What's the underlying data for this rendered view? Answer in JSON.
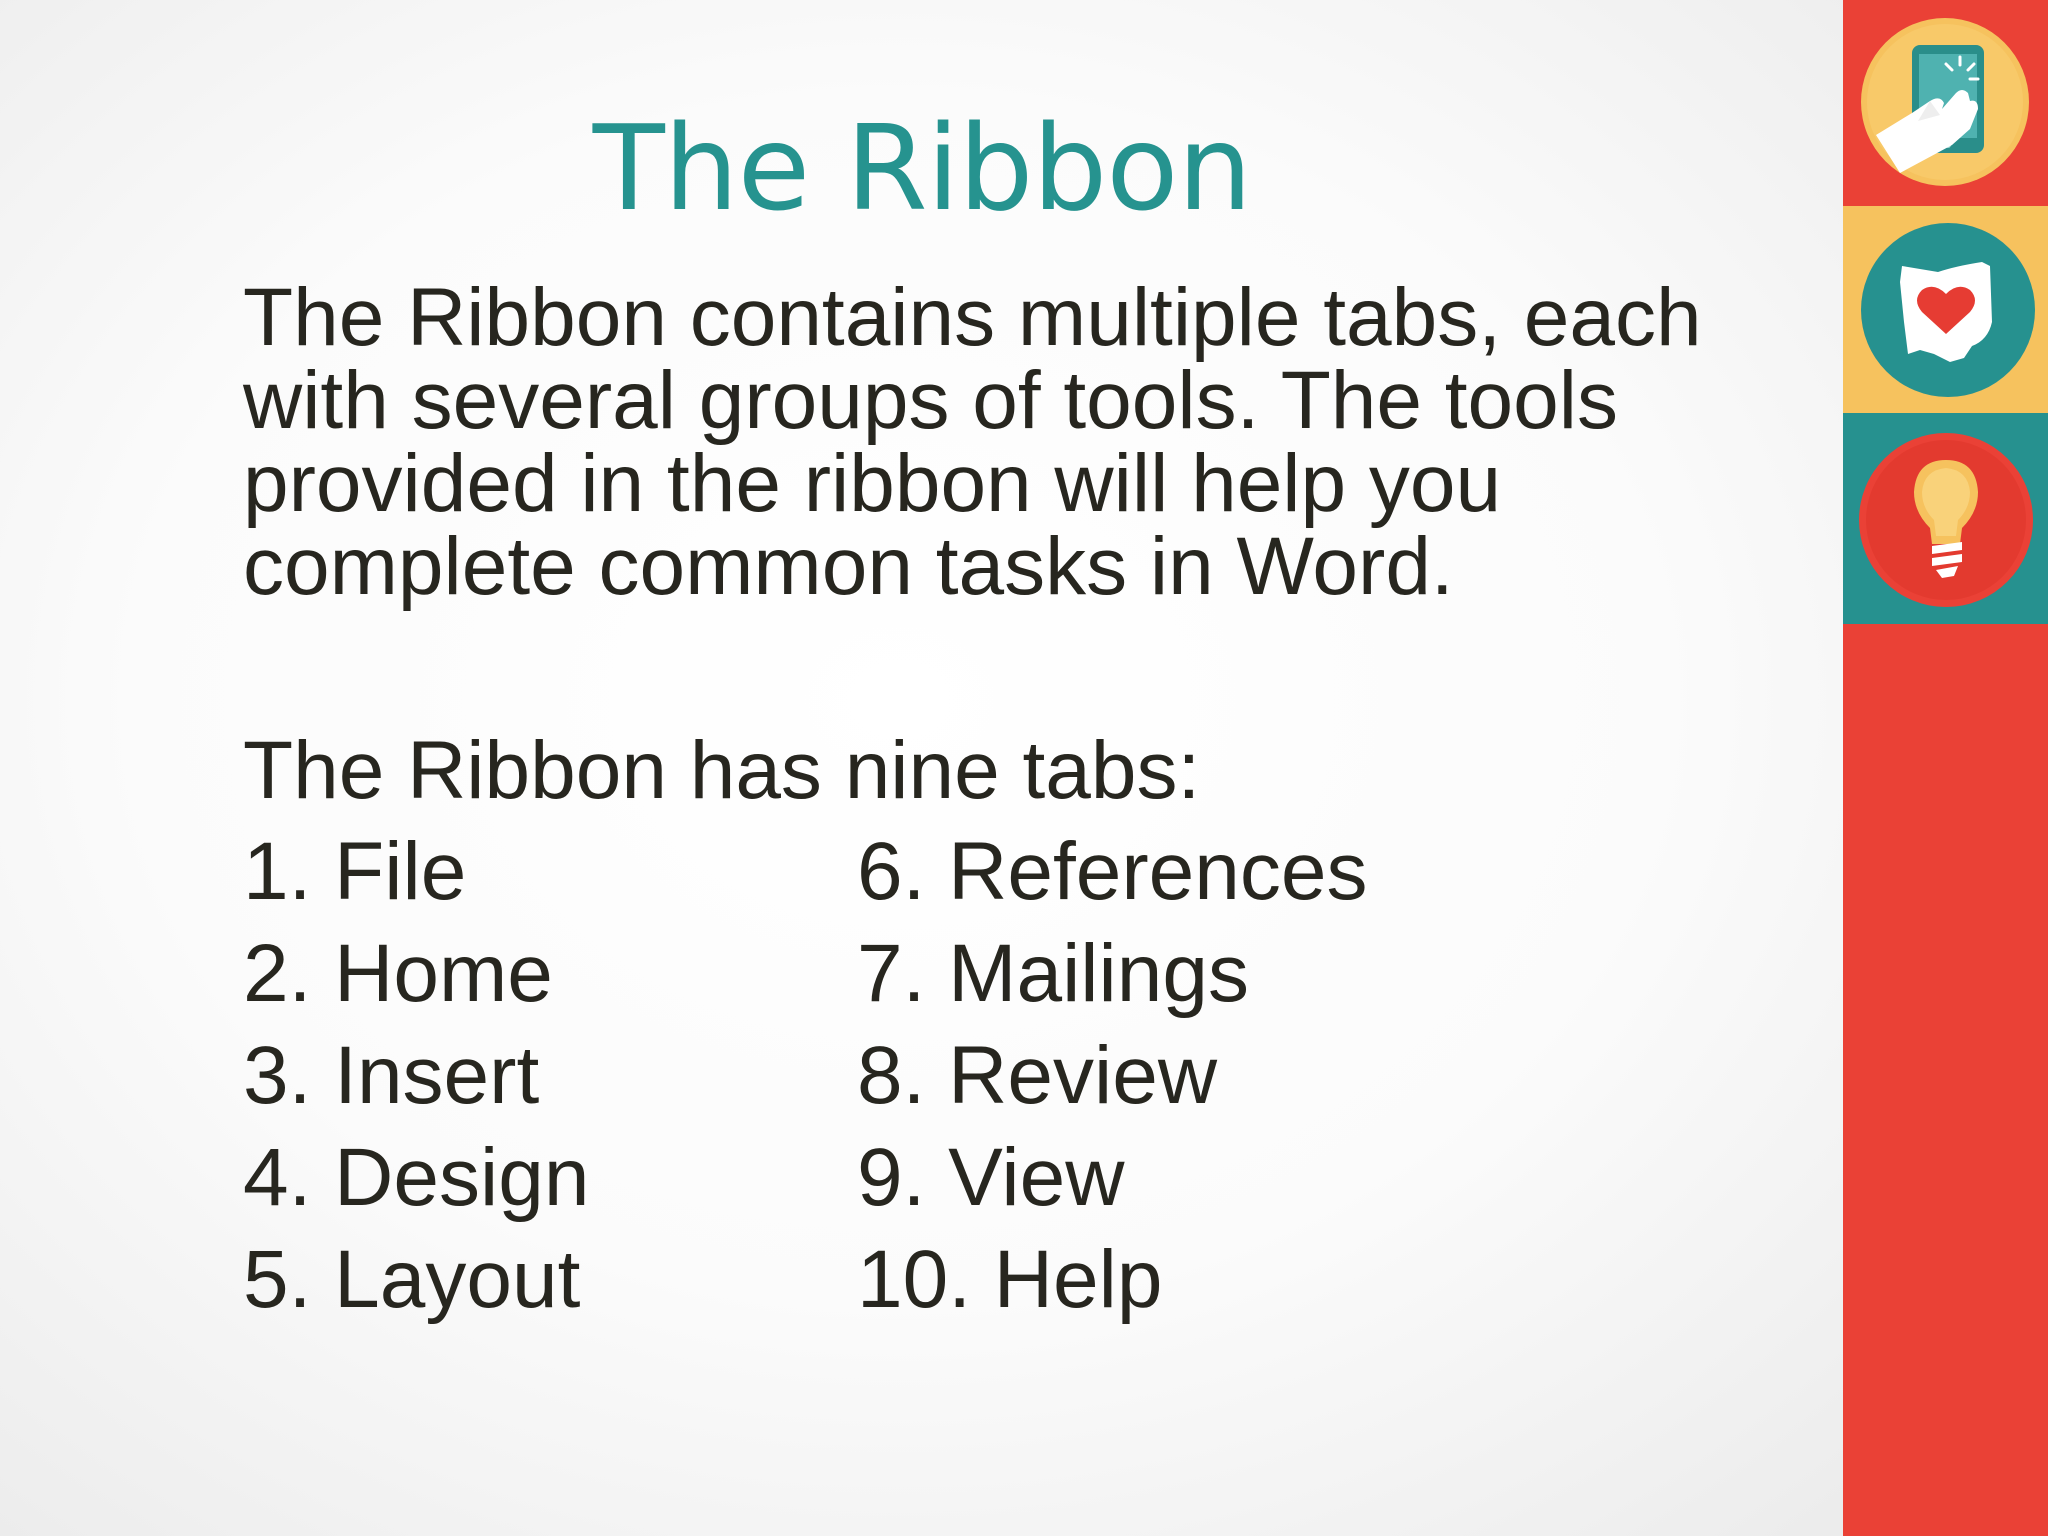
{
  "slide": {
    "title": "The Ribbon",
    "intro_lines": [
      "The Ribbon contains multiple tabs, each",
      "with several groups of tools.  The tools",
      "provided in the ribbon will help you",
      "complete common tasks in Word."
    ],
    "tabs_heading": "The Ribbon has nine tabs:",
    "tabs_left": [
      "1. File",
      "2. Home",
      "3. Insert",
      "4. Design",
      "5. Layout"
    ],
    "tabs_right": [
      "6. References",
      "7. Mailings",
      "8. Review",
      "9. View",
      "10. Help"
    ]
  },
  "sidebar": {
    "icons": [
      "tablet-touch-icon",
      "ohio-heart-icon",
      "lightbulb-icon"
    ]
  },
  "colors": {
    "title": "#26938f",
    "body_text": "#27261f",
    "sidebar_red": "#ea4136",
    "sidebar_yellow": "#f6c25e",
    "sidebar_teal": "#26918f"
  }
}
